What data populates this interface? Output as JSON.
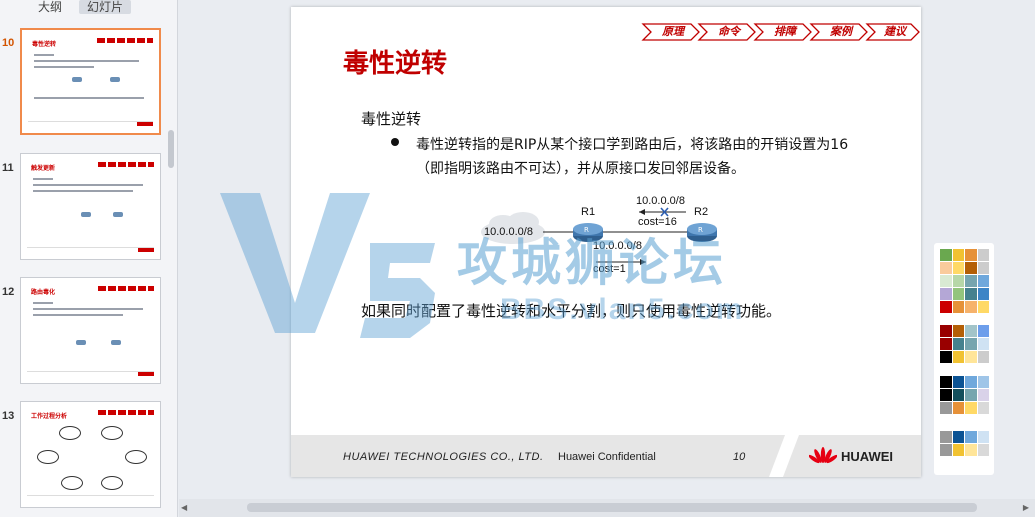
{
  "pane_tabs": {
    "outline": "大纲",
    "slides": "幻灯片"
  },
  "thumbnails": [
    {
      "number": "10",
      "title": "毒性逆转",
      "active": true
    },
    {
      "number": "11",
      "title": "触发更新",
      "active": false
    },
    {
      "number": "12",
      "title": "路由毒化",
      "active": false
    },
    {
      "number": "13",
      "title": "工作过程分析",
      "active": false
    }
  ],
  "slide": {
    "title": "毒性逆转",
    "nav_tabs": [
      "原理",
      "命令",
      "排障",
      "案例",
      "建议"
    ],
    "subtitle": "毒性逆转",
    "bullet_line1": "毒性逆转指的是RIP从某个接口学到路由后，将该路由的开销设置为16",
    "bullet_line2": "（即指明该路由不可达），并从原接口发回邻居设备。",
    "diagram": {
      "cloud_label": "10.0.0.0/8",
      "r1_label": "R1",
      "r2_label": "R2",
      "top_route": "10.0.0.0/8",
      "top_cost": "cost=16",
      "bottom_route": "10.0.0.0/8",
      "bottom_cost": "cost=1"
    },
    "conclusion": "如果同时配置了毒性逆转和水平分割，则只使用毒性逆转功能。",
    "footer": {
      "company": "HUAWEI TECHNOLOGIES CO., LTD.",
      "confidential": "Huawei Confidential",
      "page": "10",
      "logo_text": "HUAWEI"
    }
  },
  "watermark": {
    "main": "攻城狮论坛",
    "url": "BBS.vlan5.com"
  },
  "colors": {
    "accent_red": "#c00000",
    "watermark_blue": "#5aa0d2",
    "swatch_rows": [
      [
        "#6aa84f",
        "#f1c232",
        "#e69138",
        "#cccccc"
      ],
      [
        "#f9cb9c",
        "#ffd966",
        "#b45f06",
        "#cccccc"
      ],
      [
        "#d9ead3",
        "#b6d7a8",
        "#76a5af",
        "#6fa8dc"
      ],
      [
        "#b4a7d6",
        "#93c47d",
        "#45818e",
        "#3d85c6"
      ],
      [
        "#cc0000",
        "#e69138",
        "#f6b26b",
        "#ffd966"
      ],
      [
        "#990000",
        "#b45f06",
        "#a2c4c9",
        "#6d9eeb"
      ],
      [
        "#990000",
        "#45818e",
        "#76a5af",
        "#cfe2f3"
      ],
      [
        "#000000",
        "#f1c232",
        "#ffe599",
        "#cccccc"
      ],
      [
        "#000000",
        "#0b5394",
        "#6fa8dc",
        "#9fc5e8"
      ],
      [
        "#000000",
        "#134f5c",
        "#76a5af",
        "#d9d2e9"
      ],
      [
        "#999999",
        "#e69138",
        "#ffd966",
        "#d9d9d9"
      ],
      [
        "#999999",
        "#0b5394",
        "#6fa8dc",
        "#cfe2f3"
      ],
      [
        "#999999",
        "#f1c232",
        "#ffe599",
        "#d9d9d9"
      ]
    ]
  }
}
